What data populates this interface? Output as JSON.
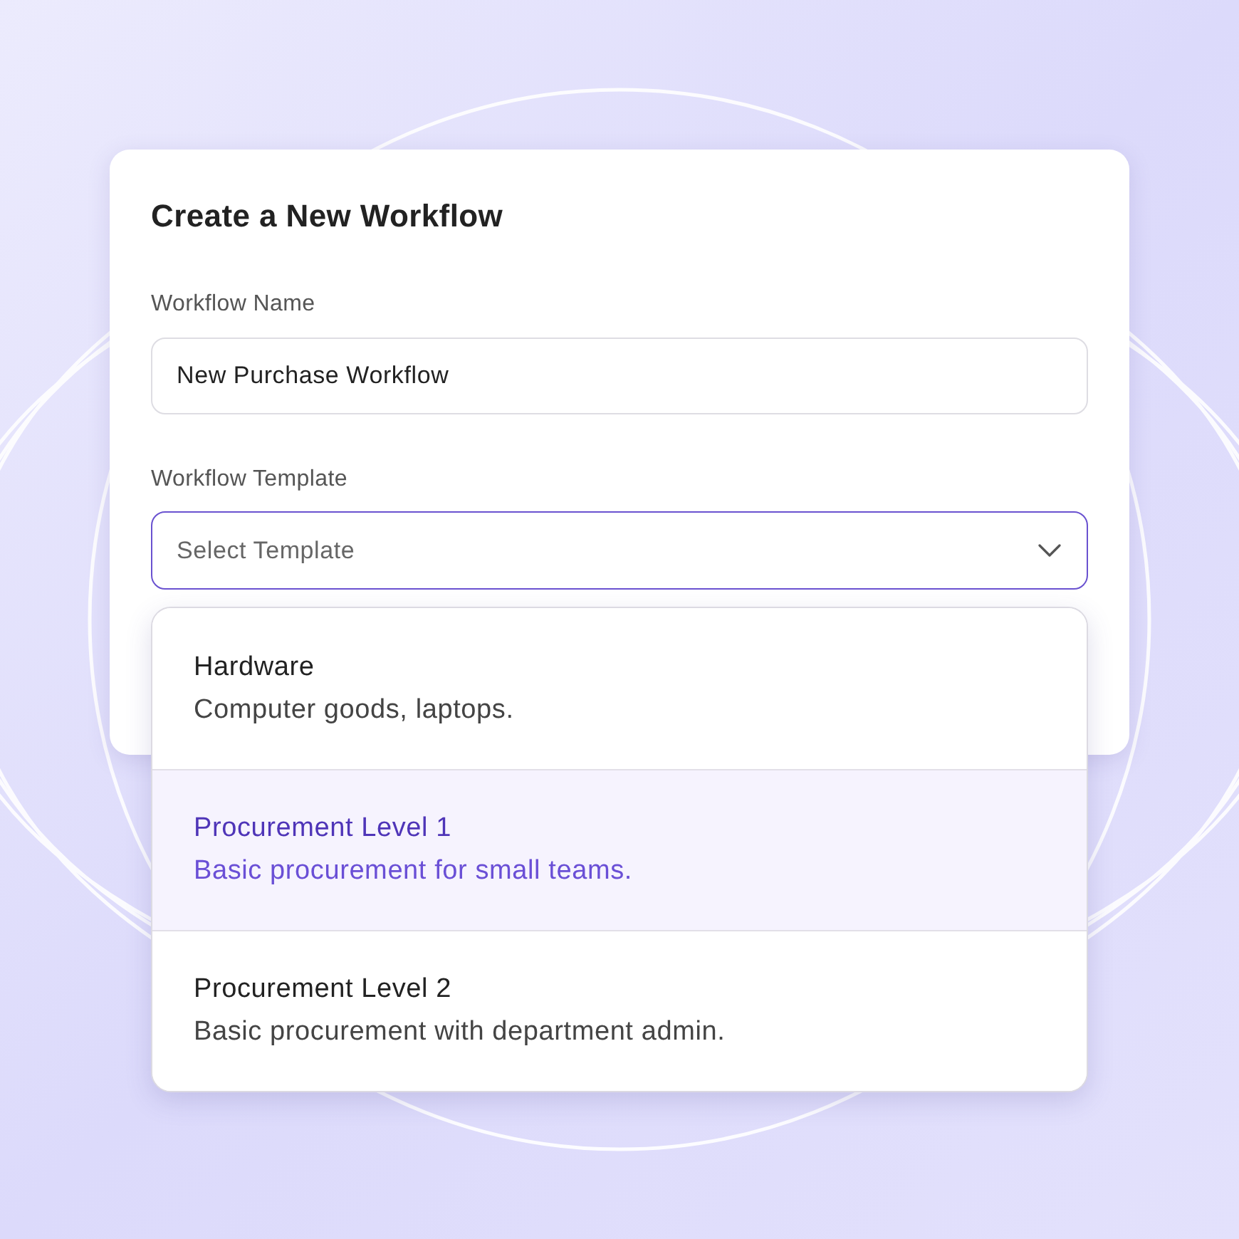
{
  "dialog": {
    "title": "Create a New Workflow",
    "fields": [
      {
        "kind": "text",
        "label": "Workflow Name",
        "value": "New Purchase Workflow"
      },
      {
        "kind": "select",
        "label": "Workflow Template",
        "placeholder": "Select Template",
        "expanded": true,
        "options": [
          {
            "title": "Hardware",
            "description": "Computer goods, laptops.",
            "selected": false
          },
          {
            "title": "Procurement Level 1",
            "description": "Basic procurement for small teams.",
            "selected": true
          },
          {
            "title": "Procurement Level 2",
            "description": "Basic procurement with department admin.",
            "selected": false
          }
        ]
      }
    ]
  }
}
